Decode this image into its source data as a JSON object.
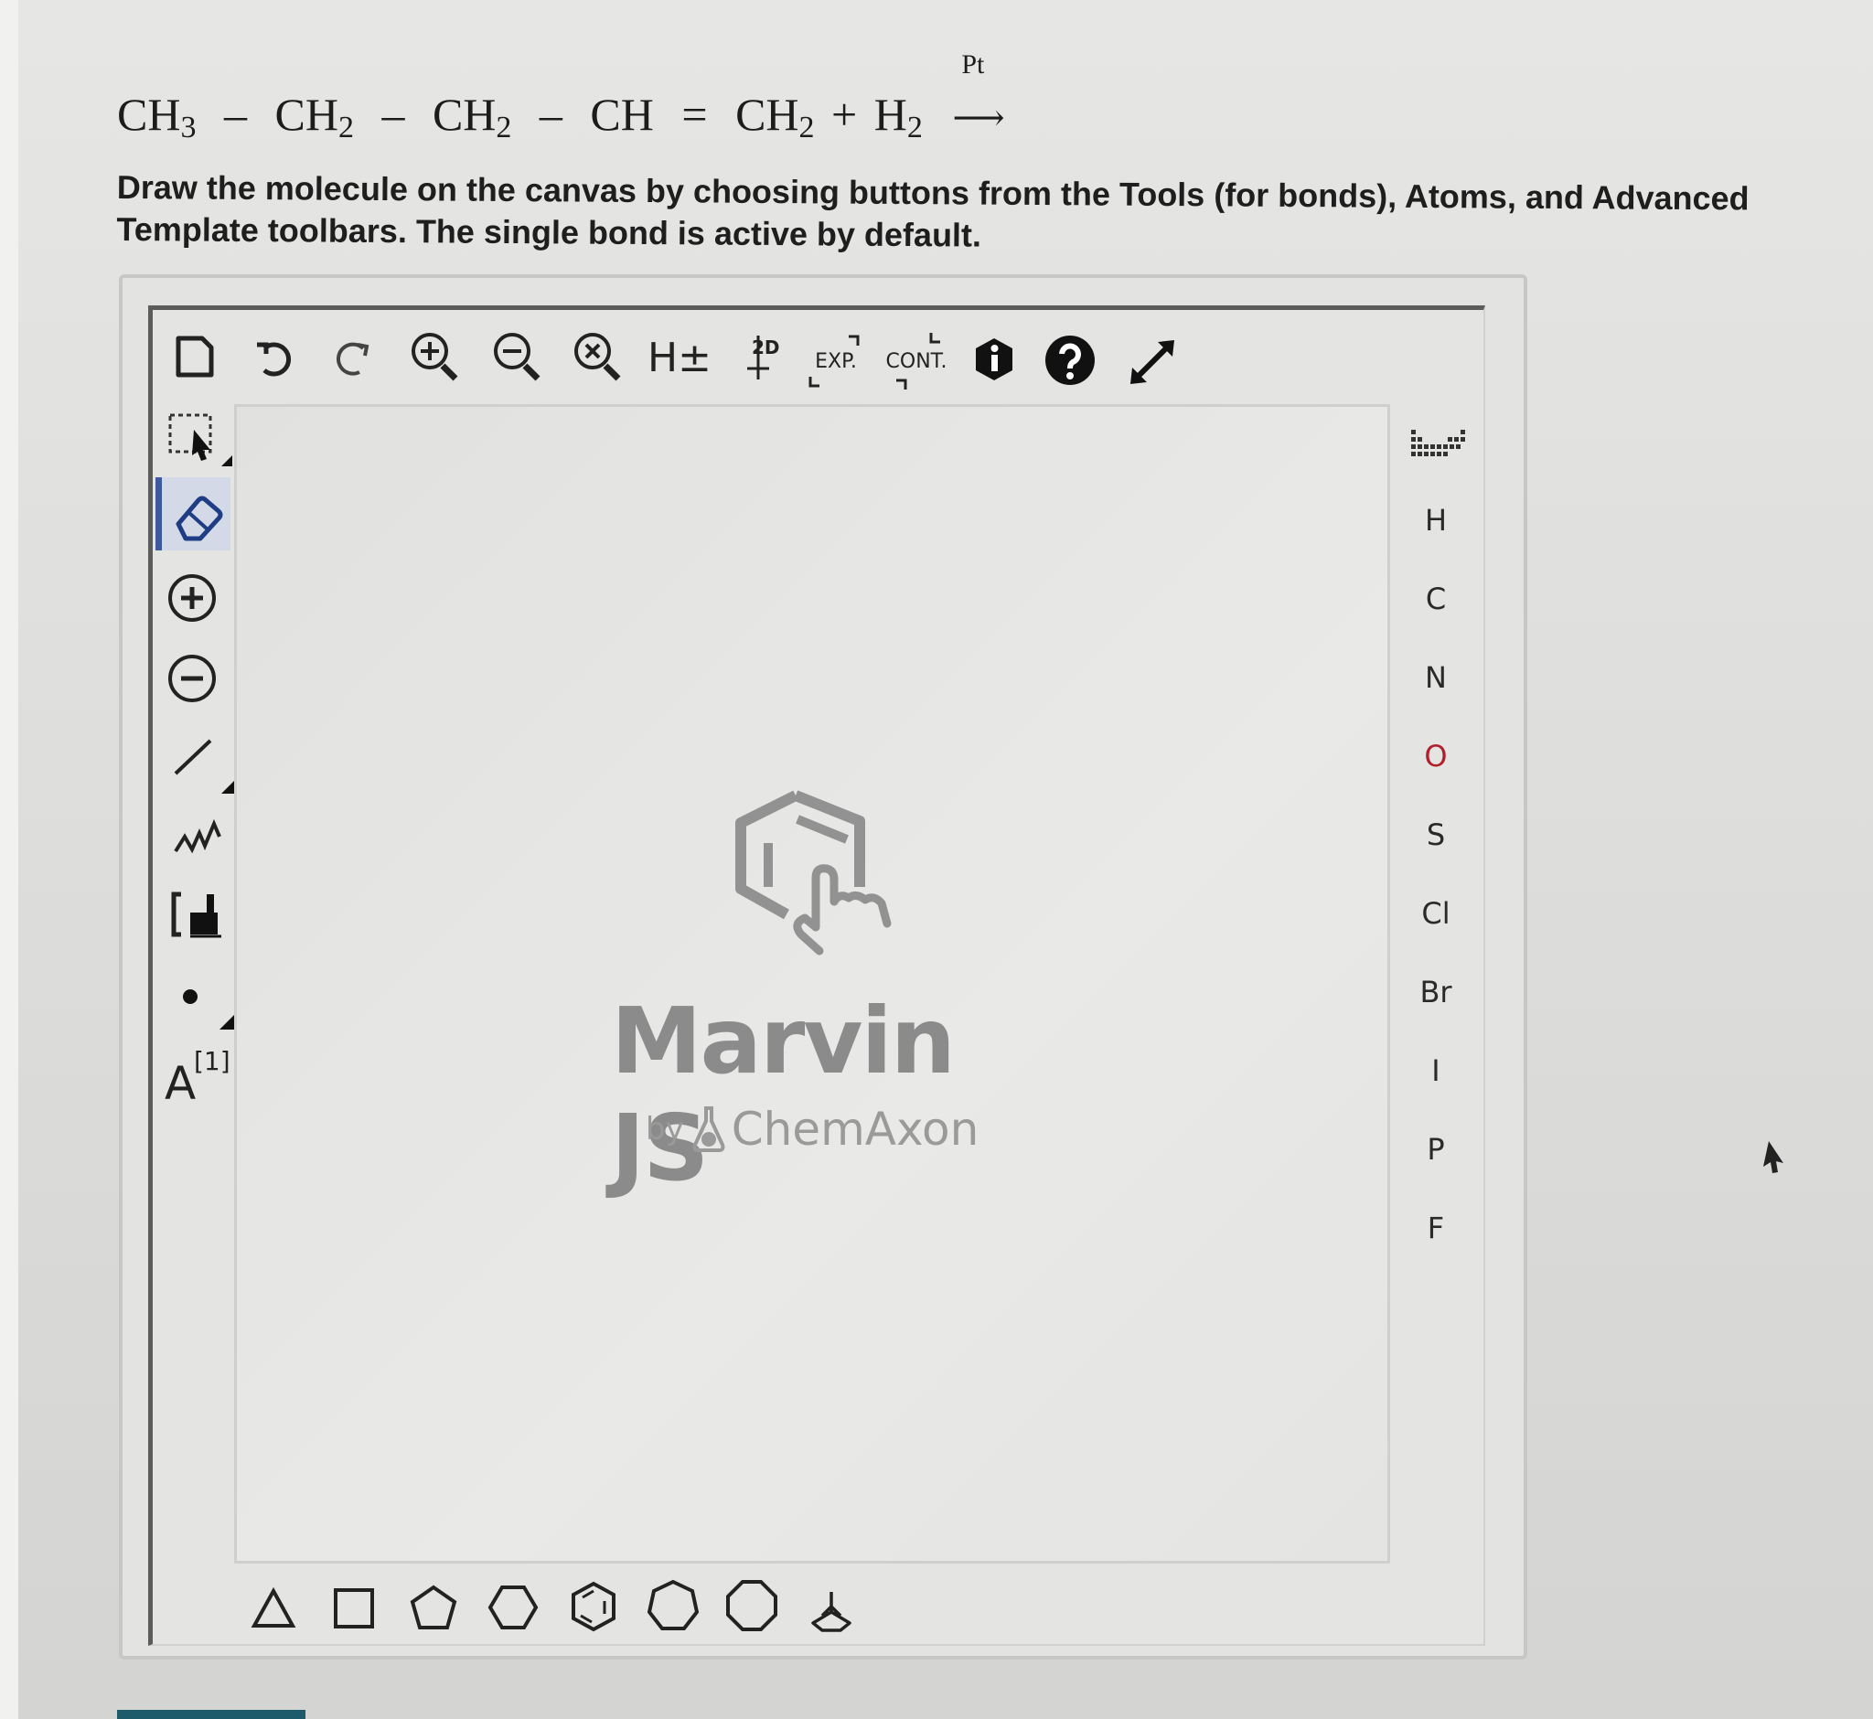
{
  "question": {
    "equation": {
      "terms": [
        {
          "base": "CH",
          "sub": "3"
        },
        {
          "base": "CH",
          "sub": "2"
        },
        {
          "base": "CH",
          "sub": "2"
        },
        {
          "base": "CH",
          "sub": ""
        },
        {
          "base": "CH",
          "sub": "2"
        },
        {
          "base": "H",
          "sub": "2"
        }
      ],
      "single_bond": "–",
      "double_bond": "=",
      "plus": "+",
      "catalyst": "Pt",
      "arrow": "⟶"
    },
    "instructions": "Draw the molecule on the canvas by choosing buttons from the Tools (for bonds), Atoms, and Advanced Template toolbars. The single bond is active by default."
  },
  "top_toolbar": {
    "hydrogen_label": "H±",
    "clean_label": "2D",
    "expand_label": "EXP.",
    "contract_label": "CONT."
  },
  "left_toolbar": {
    "atom_map_label": "A",
    "atom_map_index": "[1]"
  },
  "canvas": {
    "brand": "Marvin JS",
    "by": "by",
    "company": "ChemAxon"
  },
  "atoms_toolbar": {
    "atoms": [
      "H",
      "C",
      "N",
      "O",
      "S",
      "Cl",
      "Br",
      "I",
      "P",
      "F"
    ]
  },
  "colors": {
    "oxygen": "#b21e2a",
    "active_tool": "#3d5a9a",
    "logo_gray": "#8b8b8b"
  },
  "icons": [
    "new-document-icon",
    "undo-icon",
    "redo-icon",
    "zoom-in-icon",
    "zoom-out-icon",
    "zoom-reset-icon",
    "info-icon",
    "help-icon",
    "fullscreen-icon",
    "selection-icon",
    "eraser-icon",
    "charge-plus-icon",
    "charge-minus-icon",
    "single-bond-icon",
    "chain-icon",
    "bracket-icon",
    "radical-icon",
    "periodic-table-icon"
  ]
}
